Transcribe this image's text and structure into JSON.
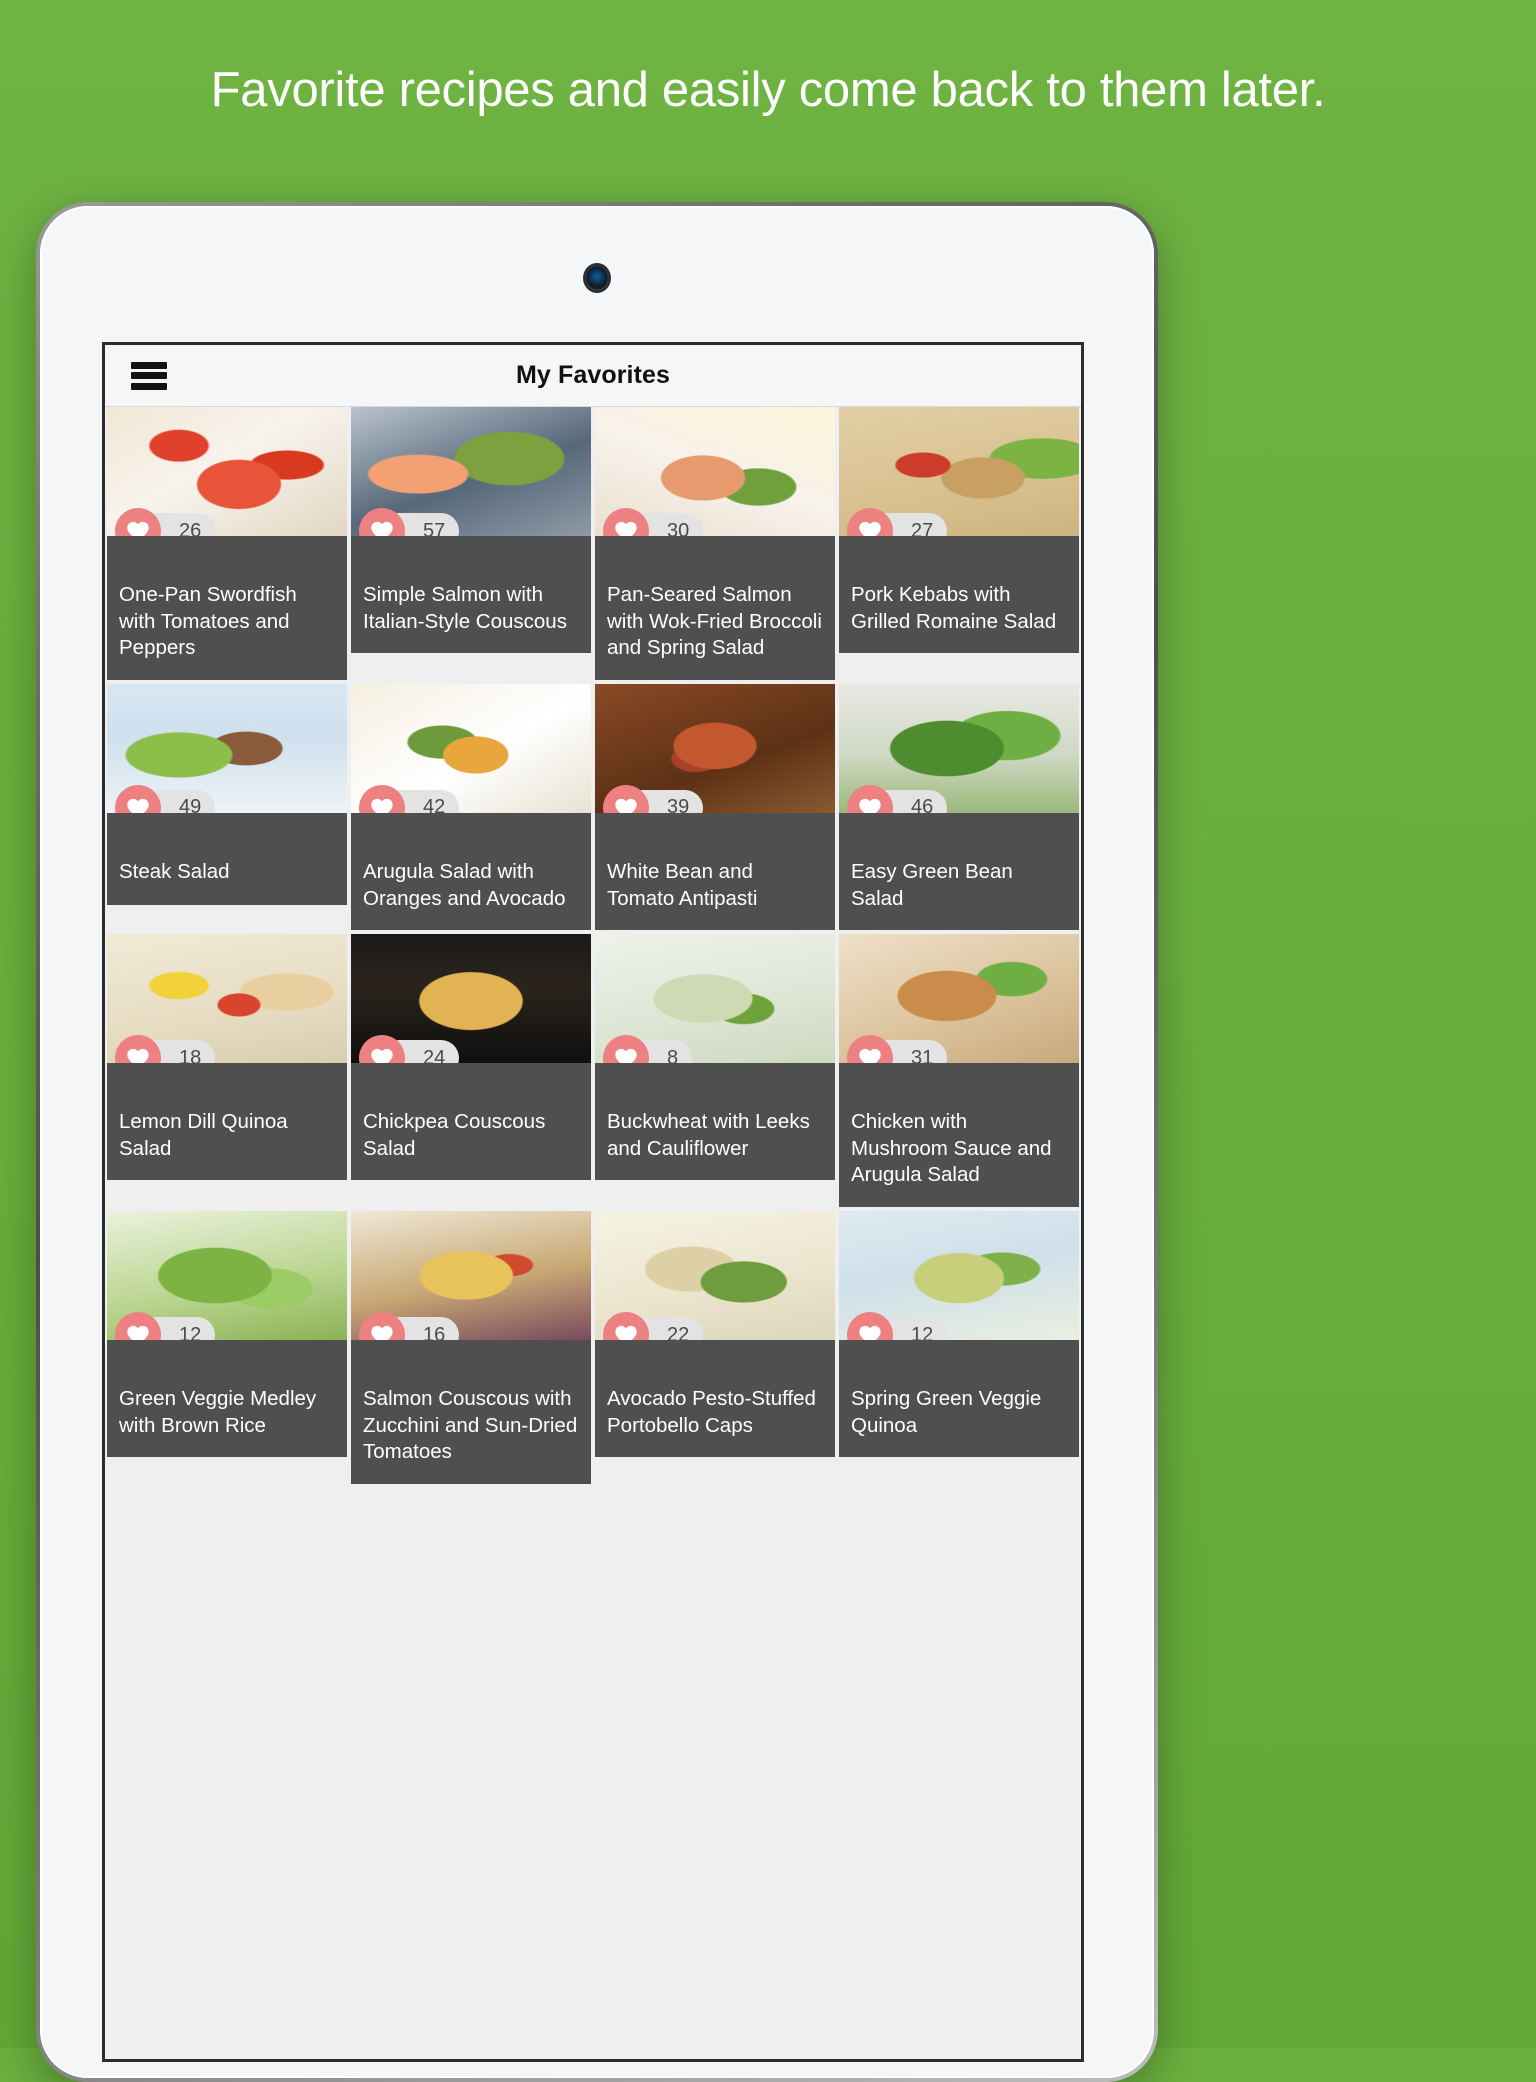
{
  "promo": {
    "headline": "Favorite recipes and easily come back to them later.",
    "background_color": "#6cb03f",
    "headline_color": "#ffffff"
  },
  "device": {
    "camera_icon": "camera-icon"
  },
  "app": {
    "menu_icon": "hamburger-menu-icon",
    "title": "My Favorites",
    "accent_color": "#ed8181",
    "caption_background": "#4f4f4f",
    "screen_background": "#efeff0"
  },
  "recipes": [
    {
      "title": "One-Pan Swordfish with Tomatoes and Peppers",
      "favorites": "26",
      "photo": "p1"
    },
    {
      "title": "Simple Salmon with Italian-Style Couscous",
      "favorites": "57",
      "photo": "p2"
    },
    {
      "title": "Pan-Seared Salmon with Wok-Fried Broccoli and Spring Salad",
      "favorites": "30",
      "photo": "p3"
    },
    {
      "title": "Pork Kebabs with Grilled Romaine Salad",
      "favorites": "27",
      "photo": "p4"
    },
    {
      "title": "Steak Salad",
      "favorites": "49",
      "photo": "p5"
    },
    {
      "title": "Arugula Salad with Oranges and Avocado",
      "favorites": "42",
      "photo": "p6"
    },
    {
      "title": "White Bean and Tomato Antipasti",
      "favorites": "39",
      "photo": "p7"
    },
    {
      "title": "Easy Green Bean Salad",
      "favorites": "46",
      "photo": "p8"
    },
    {
      "title": "Lemon Dill Quinoa Salad",
      "favorites": "18",
      "photo": "p9"
    },
    {
      "title": "Chickpea Couscous Salad",
      "favorites": "24",
      "photo": "p10"
    },
    {
      "title": "Buckwheat with Leeks and Cauliflower",
      "favorites": "8",
      "photo": "p11"
    },
    {
      "title": "Chicken with Mushroom Sauce and Arugula Salad",
      "favorites": "31",
      "photo": "p12"
    },
    {
      "title": "Green Veggie Medley with Brown Rice",
      "favorites": "12",
      "photo": "p13"
    },
    {
      "title": "Salmon Couscous with Zucchini and Sun-Dried Tomatoes",
      "favorites": "16",
      "photo": "p14"
    },
    {
      "title": "Avocado Pesto-Stuffed Portobello Caps",
      "favorites": "22",
      "photo": "p15"
    },
    {
      "title": "Spring Green Veggie Quinoa",
      "favorites": "12",
      "photo": "p16"
    }
  ]
}
